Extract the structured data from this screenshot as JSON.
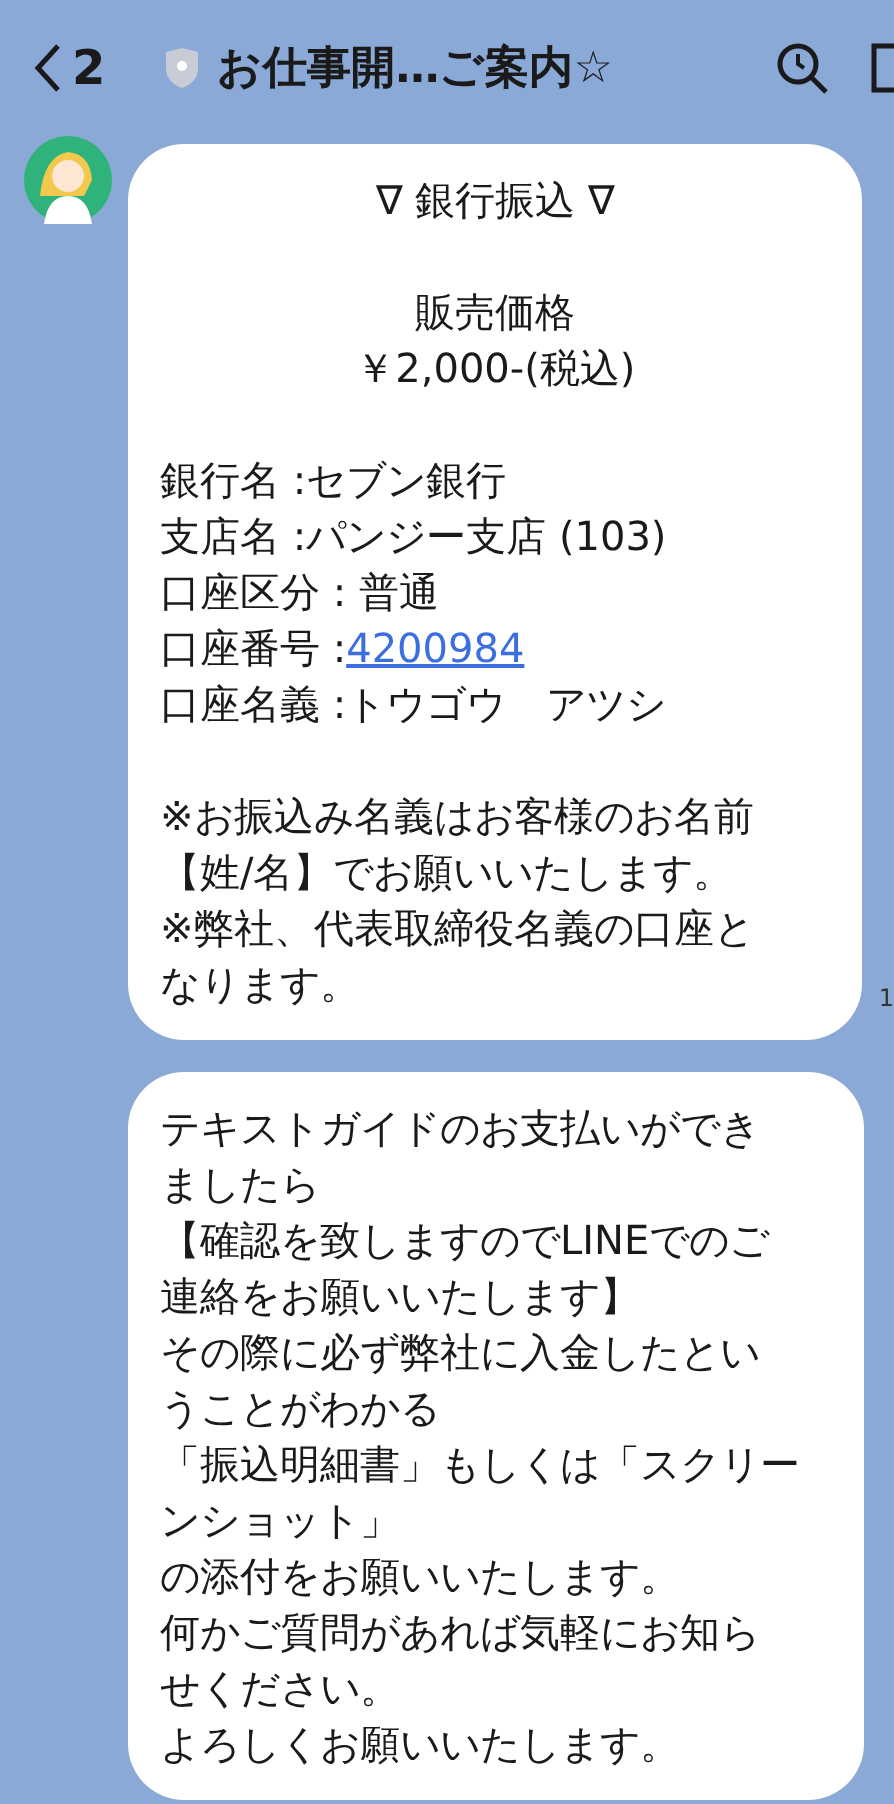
{
  "header": {
    "back_count": "2",
    "title": "お仕事開…ご案内☆"
  },
  "messages": [
    {
      "lines": [
        {
          "kind": "centered",
          "text": "∇ 銀行振込 ∇"
        },
        {
          "kind": "blank"
        },
        {
          "kind": "centered",
          "text": "販売価格"
        },
        {
          "kind": "centered",
          "text": "￥2,000-(税込)"
        },
        {
          "kind": "blank"
        },
        {
          "kind": "plain",
          "text": "銀行名 :セブン銀行"
        },
        {
          "kind": "plain",
          "text": "支店名 :パンジー支店 (103)"
        },
        {
          "kind": "plain",
          "text": "口座区分 : 普通"
        },
        {
          "kind": "plain",
          "text": "口座番号 :",
          "link": "4200984"
        },
        {
          "kind": "plain",
          "text": "口座名義 :トウゴウ　アツシ"
        },
        {
          "kind": "blank"
        },
        {
          "kind": "plain",
          "text": "※お振込み名義はお客様のお名前"
        },
        {
          "kind": "plain",
          "text": "【姓/名】でお願いいたします。"
        },
        {
          "kind": "plain",
          "text": "※弊社、代表取締役名義の口座と"
        },
        {
          "kind": "plain",
          "text": "なります。"
        }
      ],
      "timestamp": "1"
    },
    {
      "lines": [
        {
          "kind": "plain",
          "text": "テキストガイドのお支払いができ"
        },
        {
          "kind": "plain",
          "text": "ましたら"
        },
        {
          "kind": "plain",
          "text": "【確認を致しますのでLINEでのご"
        },
        {
          "kind": "plain",
          "text": "連絡をお願いいたします】"
        },
        {
          "kind": "plain",
          "text": "その際に必ず弊社に入金したとい"
        },
        {
          "kind": "plain",
          "text": "うことがわかる"
        },
        {
          "kind": "plain",
          "text": "「振込明細書」もしくは「スクリー"
        },
        {
          "kind": "plain",
          "text": "ンショット」"
        },
        {
          "kind": "plain",
          "text": "の添付をお願いいたします。"
        },
        {
          "kind": "plain",
          "text": "何かご質問があれば気軽にお知ら"
        },
        {
          "kind": "plain",
          "text": "せください。"
        },
        {
          "kind": "plain",
          "text": "よろしくお願いいたします。"
        }
      ]
    }
  ]
}
